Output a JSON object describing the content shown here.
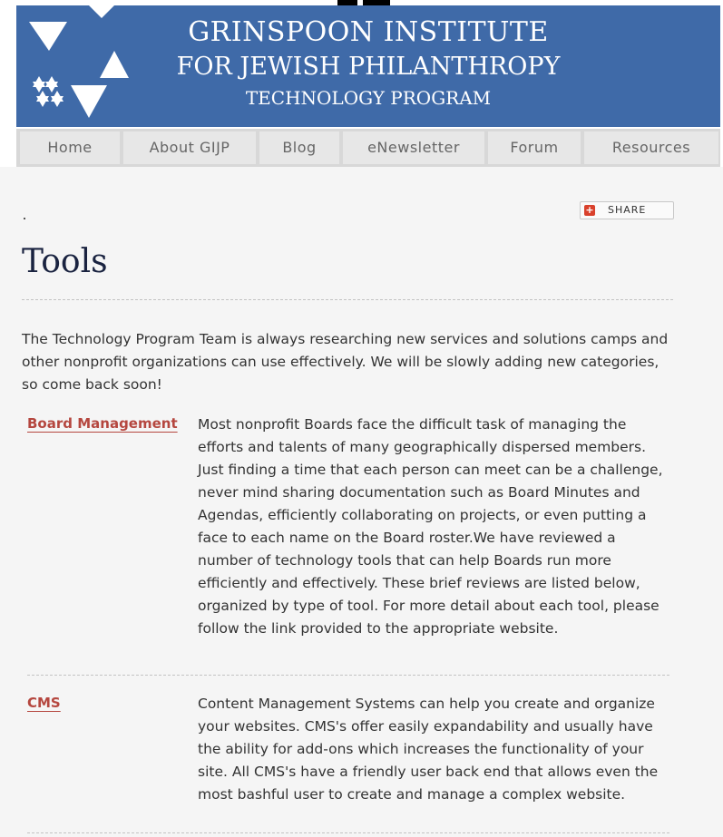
{
  "header": {
    "line1": "GRINSPOON INSTITUTE",
    "line2": "FOR JEWISH PHILANTHROPY",
    "line3": "TECHNOLOGY PROGRAM",
    "logo": "star-of-david-logo"
  },
  "nav": {
    "items": [
      {
        "label": "Home"
      },
      {
        "label": "About GIJP"
      },
      {
        "label": "Blog"
      },
      {
        "label": "eNewsletter"
      },
      {
        "label": "Forum"
      },
      {
        "label": "Resources"
      }
    ]
  },
  "share": {
    "label": "SHARE",
    "icon": "plus-icon"
  },
  "main": {
    "title": "Tools",
    "intro": "The Technology Program Team is always researching new services and solutions camps and other nonprofit organizations can use effectively. We will be slowly adding new categories, so come back soon!",
    "tools": [
      {
        "name": "Board Management",
        "description": "Most nonprofit Boards face the difficult task of managing the efforts and talents of many geographically dispersed members. Just finding a time that each person can meet can be a challenge, never mind sharing documentation such as Board Minutes and Agendas, efficiently collaborating on projects, or even putting a face to each name on the Board roster.We have reviewed a number of technology tools that can help Boards run more efficiently and effectively. These brief reviews are listed below, organized by type of tool. For more detail about each tool, please follow the link provided to the appropriate website."
      },
      {
        "name": "CMS",
        "description": "Content Management Systems can help you create and organize your websites. CMS's offer easily expandability and usually have the ability for add-ons which increases the functionality of your site. All CMS's have a friendly user back end that allows even the most bashful user to create and manage a complex website."
      }
    ]
  },
  "colors": {
    "banner": "#3f6aa8",
    "link": "#b5473f",
    "title": "#1a2340"
  }
}
